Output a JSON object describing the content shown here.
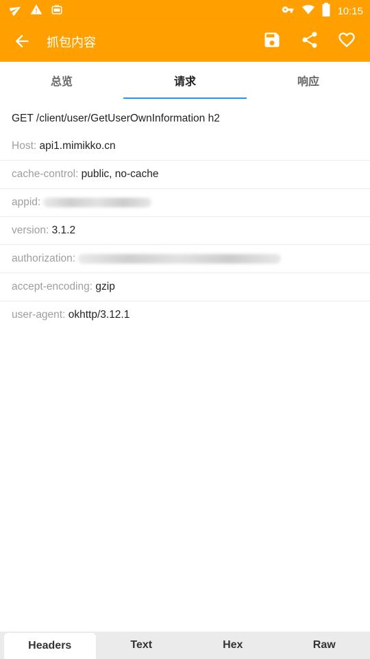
{
  "status_bar": {
    "time": "10:15",
    "icons": [
      "send-notification-icon",
      "warning-icon",
      "game-icon",
      "vpn-key-icon",
      "wifi-icon",
      "battery-icon"
    ]
  },
  "app_bar": {
    "title": "抓包内容",
    "color": "#FFA000",
    "actions": [
      "save-icon",
      "share-icon",
      "favorite-icon"
    ]
  },
  "tabs": [
    {
      "label": "总览",
      "active": false
    },
    {
      "label": "请求",
      "active": true
    },
    {
      "label": "响应",
      "active": false
    }
  ],
  "request_line": "GET /client/user/GetUserOwnInformation h2",
  "headers": [
    {
      "key": "Host",
      "value": "api1.mimikko.cn"
    },
    {
      "key": "cache-control",
      "value": "public, no-cache"
    },
    {
      "key": "appid",
      "value": "",
      "redacted": true
    },
    {
      "key": "version",
      "value": "3.1.2"
    },
    {
      "key": "authorization",
      "value": "",
      "redacted": true
    },
    {
      "key": "accept-encoding",
      "value": "gzip"
    },
    {
      "key": "user-agent",
      "value": "okhttp/3.12.1"
    }
  ],
  "bottom_tabs": [
    {
      "label": "Headers",
      "active": true
    },
    {
      "label": "Text",
      "active": false
    },
    {
      "label": "Hex",
      "active": false
    },
    {
      "label": "Raw",
      "active": false
    }
  ],
  "colors": {
    "accent": "#2196F3",
    "primary": "#FFA000"
  }
}
